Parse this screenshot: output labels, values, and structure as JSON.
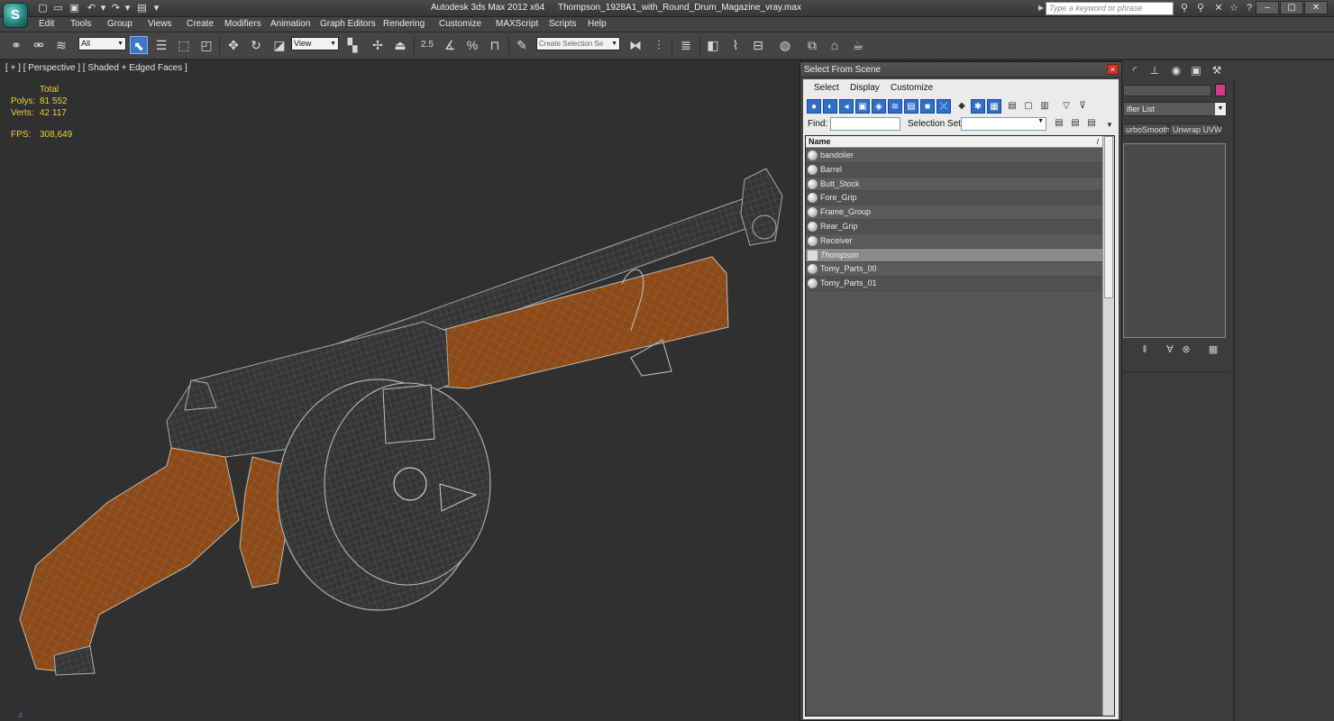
{
  "titlebar": {
    "app_name": "Autodesk 3ds Max  2012 x64",
    "file_name": "Thompson_1928A1_with_Round_Drum_Magazine_vray.max",
    "search_placeholder": "Type a keyword or phrase",
    "logo_icon": "3dsmax-logo-icon"
  },
  "menu": [
    "Edit",
    "Tools",
    "Group",
    "Views",
    "Create",
    "Modifiers",
    "Animation",
    "Graph Editors",
    "Rendering",
    "Customize",
    "MAXScript",
    "Scripts",
    "Help"
  ],
  "toolbar": {
    "selection_filter": "All",
    "reference_coord": "View",
    "snap_angle_label": "2.5",
    "named_selection_placeholder": "Create Selection Se"
  },
  "viewport": {
    "label": "[ + ] [ Perspective ] [ Shaded + Edged Faces ]",
    "stats": {
      "header": "Total",
      "polys_label": "Polys:",
      "polys_value": "81 552",
      "verts_label": "Verts:",
      "verts_value": "42 117",
      "fps_label": "FPS:",
      "fps_value": "308,649"
    },
    "axis_label": "z",
    "colors": {
      "wood": "#8b4a17",
      "metal": "#3a3a3a",
      "wire": "#a8a8a8"
    }
  },
  "dialog": {
    "title": "Select From Scene",
    "close_label": "×",
    "menu": [
      "Select",
      "Display",
      "Customize"
    ],
    "find_label": "Find:",
    "selection_set_label": "Selection Set:",
    "column_name": "Name",
    "sort_glyph": "/",
    "objects": [
      {
        "name": "bandolier",
        "selected": false
      },
      {
        "name": "Barrel",
        "selected": false
      },
      {
        "name": "Butt_Stock",
        "selected": false
      },
      {
        "name": "Fore_Grip",
        "selected": false
      },
      {
        "name": "Frame_Group",
        "selected": false
      },
      {
        "name": "Rear_Grip",
        "selected": false
      },
      {
        "name": "Receiver",
        "selected": false
      },
      {
        "name": "Thompson",
        "selected": true
      },
      {
        "name": "Tomy_Parts_00",
        "selected": false
      },
      {
        "name": "Tomy_Parts_01",
        "selected": false
      }
    ]
  },
  "command_panel": {
    "modifier_list": "ifier List",
    "buttons": [
      "urboSmooth",
      "Unwrap UVW"
    ],
    "color_swatch": "#d13d8b"
  }
}
